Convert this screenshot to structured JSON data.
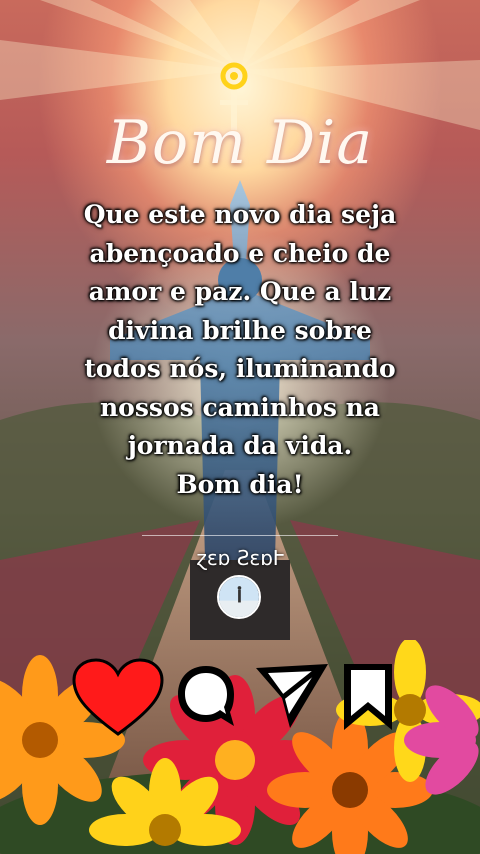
{
  "greeting": {
    "title": "Bom Dia",
    "message_lines": [
      "Que este novo dia seja",
      "abençoado e cheio de",
      "amor e paz. Que a luz",
      "divina brilhe sobre",
      "todos nós, iluminando",
      "nossos caminhos na",
      "jornada da vida.",
      "Bom dia!"
    ],
    "signature": "ɀɛɒ ƧɛɒՒ"
  },
  "actions": {
    "like": "heart-icon",
    "comment": "comment-icon",
    "share": "send-icon",
    "save": "bookmark-icon"
  },
  "colors": {
    "heart": "#ff1a1a",
    "icon_fill": "#ffffff",
    "icon_stroke": "#000000"
  }
}
